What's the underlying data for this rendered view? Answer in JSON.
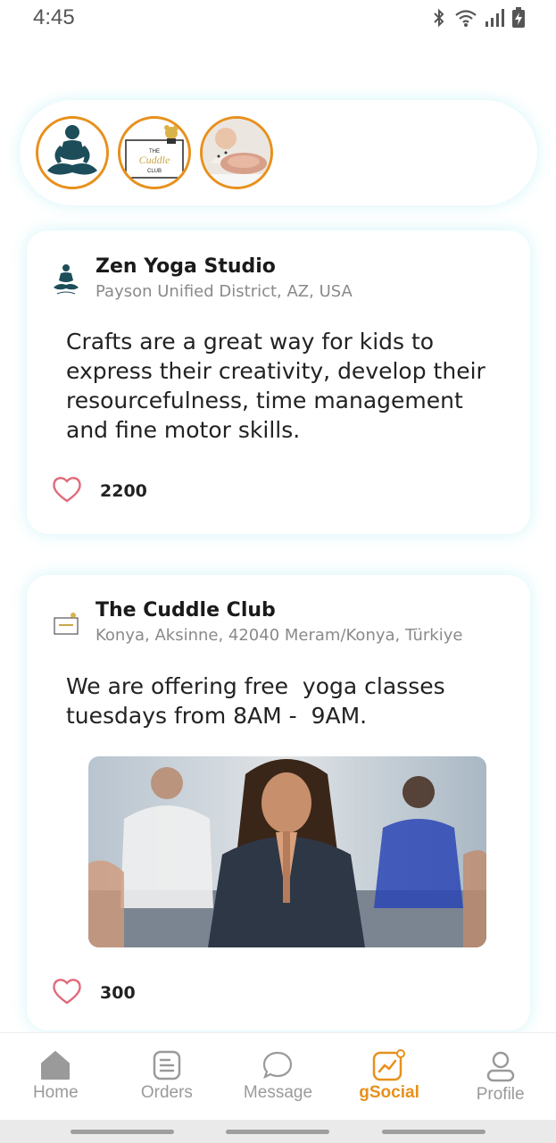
{
  "status_bar": {
    "time": "4:45",
    "icons": [
      "bluetooth-icon",
      "wifi-icon",
      "signal-icon",
      "battery-charging-icon"
    ]
  },
  "stories": [
    {
      "name": "zen-yoga-studio",
      "icon": "meditation-logo"
    },
    {
      "name": "the-cuddle-club",
      "icon": "cuddle-club-logo",
      "logo_text": [
        "THE",
        "Cuddle",
        "CLUB"
      ]
    },
    {
      "name": "baby-food",
      "icon": "baby-photo"
    }
  ],
  "posts": [
    {
      "author": "Zen Yoga Studio",
      "location": "Payson Unified District, AZ, USA",
      "text": "Crafts are a great way for kids to express their creativity, develop their resourcefulness, time management and fine motor skills.",
      "likes": "2200"
    },
    {
      "author": "The Cuddle Club",
      "location": "Konya, Aksinne, 42040 Meram/Konya, Türkiye",
      "text": "We are offering free  yoga classes tuesdays from 8AM -  9AM.",
      "likes": "300"
    }
  ],
  "nav": {
    "items": [
      {
        "label": "Home",
        "icon": "home-icon"
      },
      {
        "label": "Orders",
        "icon": "orders-icon"
      },
      {
        "label": "Message",
        "icon": "message-icon"
      },
      {
        "label": "gSocial",
        "icon": "gsocial-icon",
        "active": true
      },
      {
        "label": "Profile",
        "icon": "profile-icon"
      }
    ]
  },
  "colors": {
    "accent": "#e8901c",
    "heart": "#e06a7a",
    "card_glow": "#a0e6f0",
    "yoga_teal": "#1e4d5a"
  }
}
